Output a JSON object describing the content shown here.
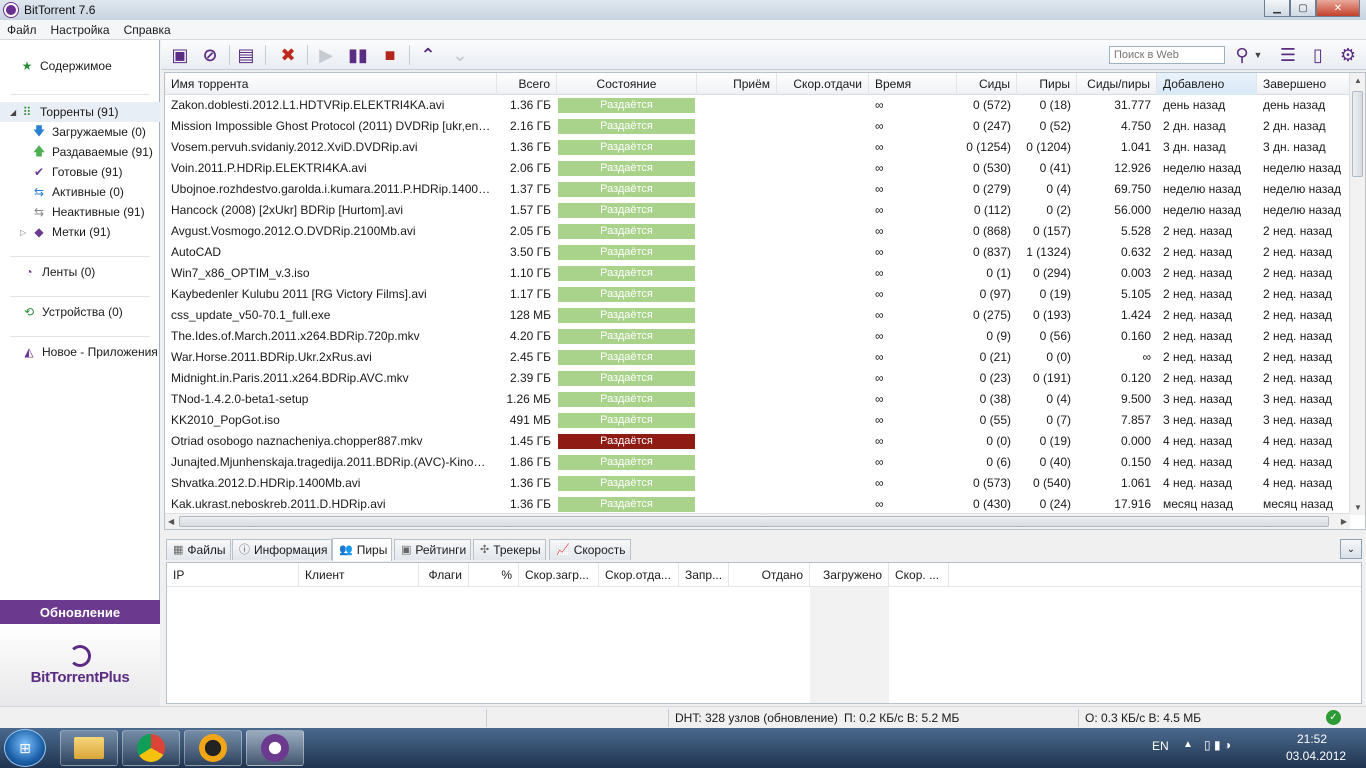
{
  "window": {
    "title": "BitTorrent 7.6"
  },
  "window_controls": {
    "minimize": "▁",
    "maximize": "▢",
    "close": "✕"
  },
  "menu": [
    "Файл",
    "Настройка",
    "Справка"
  ],
  "sidebar": {
    "content": "Содержимое",
    "torrents": "Торренты (91)",
    "downloading": "Загружаемые (0)",
    "seeding": "Раздаваемые (91)",
    "completed": "Готовые (91)",
    "active": "Активные (0)",
    "inactive": "Неактивные (91)",
    "labels": "Метки (91)",
    "feeds": "Ленты (0)",
    "devices": "Устройства (0)",
    "new_apps": "Новое - Приложения",
    "update": "Обновление",
    "logo": "BitTorrentPlus"
  },
  "toolbar": {
    "search_placeholder": "Поиск в Web",
    "icons": [
      "add-torrent-icon",
      "add-url-icon",
      "create-torrent-icon",
      "remove-icon",
      "start-icon",
      "pause-icon",
      "stop-icon",
      "move-up-icon",
      "move-down-icon",
      "search-icon",
      "list-view-icon",
      "device-icon",
      "settings-icon"
    ]
  },
  "torrent_table": {
    "columns": [
      "Имя торрента",
      "Всего",
      "Состояние",
      "Приём",
      "Скор.отдачи",
      "Время",
      "Сиды",
      "Пиры",
      "Сиды/пиры",
      "Добавлено",
      "Завершено"
    ],
    "rows": [
      {
        "name": "Zakon.doblesti.2012.L1.HDTVRip.ELEKTRI4KA.avi",
        "size": "1.36 ГБ",
        "status": "Раздаётся",
        "time": "∞",
        "seeds": "0 (572)",
        "peers": "0 (18)",
        "ratio": "31.777",
        "added": "день назад",
        "completed": "день назад",
        "error": false
      },
      {
        "name": "Mission Impossible Ghost Protocol (2011) DVDRip [ukr,eng]...",
        "size": "2.16 ГБ",
        "status": "Раздаётся",
        "time": "∞",
        "seeds": "0 (247)",
        "peers": "0 (52)",
        "ratio": "4.750",
        "added": "2 дн. назад",
        "completed": "2 дн. назад",
        "error": false
      },
      {
        "name": "Vosem.pervuh.svidaniy.2012.XviD.DVDRip.avi",
        "size": "1.36 ГБ",
        "status": "Раздаётся",
        "time": "∞",
        "seeds": "0 (1254)",
        "peers": "0 (1204)",
        "ratio": "1.041",
        "added": "3 дн. назад",
        "completed": "3 дн. назад",
        "error": false
      },
      {
        "name": "Voin.2011.P.HDRip.ELEKTRI4KA.avi",
        "size": "2.06 ГБ",
        "status": "Раздаётся",
        "time": "∞",
        "seeds": "0 (530)",
        "peers": "0 (41)",
        "ratio": "12.926",
        "added": "неделю назад",
        "completed": "неделю назад",
        "error": false
      },
      {
        "name": "Ubojnoe.rozhdestvo.garolda.i.kumara.2011.P.HDRip.1400M...",
        "size": "1.37 ГБ",
        "status": "Раздаётся",
        "time": "∞",
        "seeds": "0 (279)",
        "peers": "0 (4)",
        "ratio": "69.750",
        "added": "неделю назад",
        "completed": "неделю назад",
        "error": false
      },
      {
        "name": "Hancock (2008) [2xUkr] BDRip [Hurtom].avi",
        "size": "1.57 ГБ",
        "status": "Раздаётся",
        "time": "∞",
        "seeds": "0 (112)",
        "peers": "0 (2)",
        "ratio": "56.000",
        "added": "неделю назад",
        "completed": "неделю назад",
        "error": false
      },
      {
        "name": "Avgust.Vosmogo.2012.O.DVDRip.2100Mb.avi",
        "size": "2.05 ГБ",
        "status": "Раздаётся",
        "time": "∞",
        "seeds": "0 (868)",
        "peers": "0 (157)",
        "ratio": "5.528",
        "added": "2 нед. назад",
        "completed": "2 нед. назад",
        "error": false
      },
      {
        "name": "AutoCAD",
        "size": "3.50 ГБ",
        "status": "Раздаётся",
        "time": "∞",
        "seeds": "0 (837)",
        "peers": "1 (1324)",
        "ratio": "0.632",
        "added": "2 нед. назад",
        "completed": "2 нед. назад",
        "error": false
      },
      {
        "name": "Win7_x86_OPTIM_v.3.iso",
        "size": "1.10 ГБ",
        "status": "Раздаётся",
        "time": "∞",
        "seeds": "0 (1)",
        "peers": "0 (294)",
        "ratio": "0.003",
        "added": "2 нед. назад",
        "completed": "2 нед. назад",
        "error": false
      },
      {
        "name": "Kaybedenler Kulubu 2011 [RG Victory Films].avi",
        "size": "1.17 ГБ",
        "status": "Раздаётся",
        "time": "∞",
        "seeds": "0 (97)",
        "peers": "0 (19)",
        "ratio": "5.105",
        "added": "2 нед. назад",
        "completed": "2 нед. назад",
        "error": false
      },
      {
        "name": "css_update_v50-70.1_full.exe",
        "size": "128 МБ",
        "status": "Раздаётся",
        "time": "∞",
        "seeds": "0 (275)",
        "peers": "0 (193)",
        "ratio": "1.424",
        "added": "2 нед. назад",
        "completed": "2 нед. назад",
        "error": false
      },
      {
        "name": "The.Ides.of.March.2011.x264.BDRip.720p.mkv",
        "size": "4.20 ГБ",
        "status": "Раздаётся",
        "time": "∞",
        "seeds": "0 (9)",
        "peers": "0 (56)",
        "ratio": "0.160",
        "added": "2 нед. назад",
        "completed": "2 нед. назад",
        "error": false
      },
      {
        "name": "War.Horse.2011.BDRip.Ukr.2xRus.avi",
        "size": "2.45 ГБ",
        "status": "Раздаётся",
        "time": "∞",
        "seeds": "0 (21)",
        "peers": "0 (0)",
        "ratio": "∞",
        "added": "2 нед. назад",
        "completed": "2 нед. назад",
        "error": false
      },
      {
        "name": "Midnight.in.Paris.2011.x264.BDRip.AVC.mkv",
        "size": "2.39 ГБ",
        "status": "Раздаётся",
        "time": "∞",
        "seeds": "0 (23)",
        "peers": "0 (191)",
        "ratio": "0.120",
        "added": "2 нед. назад",
        "completed": "2 нед. назад",
        "error": false
      },
      {
        "name": "TNod-1.4.2.0-beta1-setup",
        "size": "1.26 МБ",
        "status": "Раздаётся",
        "time": "∞",
        "seeds": "0 (38)",
        "peers": "0 (4)",
        "ratio": "9.500",
        "added": "3 нед. назад",
        "completed": "3 нед. назад",
        "error": false
      },
      {
        "name": "KK2010_PopGot.iso",
        "size": "491 МБ",
        "status": "Раздаётся",
        "time": "∞",
        "seeds": "0 (55)",
        "peers": "0 (7)",
        "ratio": "7.857",
        "added": "3 нед. назад",
        "completed": "3 нед. назад",
        "error": false
      },
      {
        "name": "Otriad osobogo naznacheniya.chopper887.mkv",
        "size": "1.45 ГБ",
        "status": "Раздаётся",
        "time": "∞",
        "seeds": "0 (0)",
        "peers": "0 (19)",
        "ratio": "0.000",
        "added": "4 нед. назад",
        "completed": "4 нед. назад",
        "error": true
      },
      {
        "name": "Junajted.Mjunhenskaja.tragedija.2011.BDRip.(AVC)-KinoZal...",
        "size": "1.86 ГБ",
        "status": "Раздаётся",
        "time": "∞",
        "seeds": "0 (6)",
        "peers": "0 (40)",
        "ratio": "0.150",
        "added": "4 нед. назад",
        "completed": "4 нед. назад",
        "error": false
      },
      {
        "name": "Shvatka.2012.D.HDRip.1400Mb.avi",
        "size": "1.36 ГБ",
        "status": "Раздаётся",
        "time": "∞",
        "seeds": "0 (573)",
        "peers": "0 (540)",
        "ratio": "1.061",
        "added": "4 нед. назад",
        "completed": "4 нед. назад",
        "error": false
      },
      {
        "name": "Kak.ukrast.neboskreb.2011.D.HDRip.avi",
        "size": "1.36 ГБ",
        "status": "Раздаётся",
        "time": "∞",
        "seeds": "0 (430)",
        "peers": "0 (24)",
        "ratio": "17.916",
        "added": "месяц назад",
        "completed": "месяц назад",
        "error": false
      }
    ]
  },
  "detail_tabs": [
    "Файлы",
    "Информация",
    "Пиры",
    "Рейтинги",
    "Трекеры",
    "Скорость"
  ],
  "peers_table": {
    "columns": [
      "IP",
      "Клиент",
      "Флаги",
      "%",
      "Скор.загр...",
      "Скор.отда...",
      "Запр...",
      "Отдано",
      "Загружено",
      "Скор. ..."
    ]
  },
  "status_bar": {
    "dht": "DHT: 328 узлов  (обновление)",
    "download": "П: 0.2 КБ/с В: 5.2 МБ",
    "upload": "О: 0.3 КБ/с В: 4.5 МБ",
    "ok": "✓"
  },
  "taskbar": {
    "lang": "EN",
    "time": "21:52",
    "date": "03.04.2012",
    "apps": [
      "explorer-icon",
      "chrome-icon",
      "aimp-icon",
      "bittorrent-icon"
    ]
  },
  "colors": {
    "accent": "#6b3a8f",
    "seeding": "#a9d38a",
    "error": "#8e1b14"
  }
}
